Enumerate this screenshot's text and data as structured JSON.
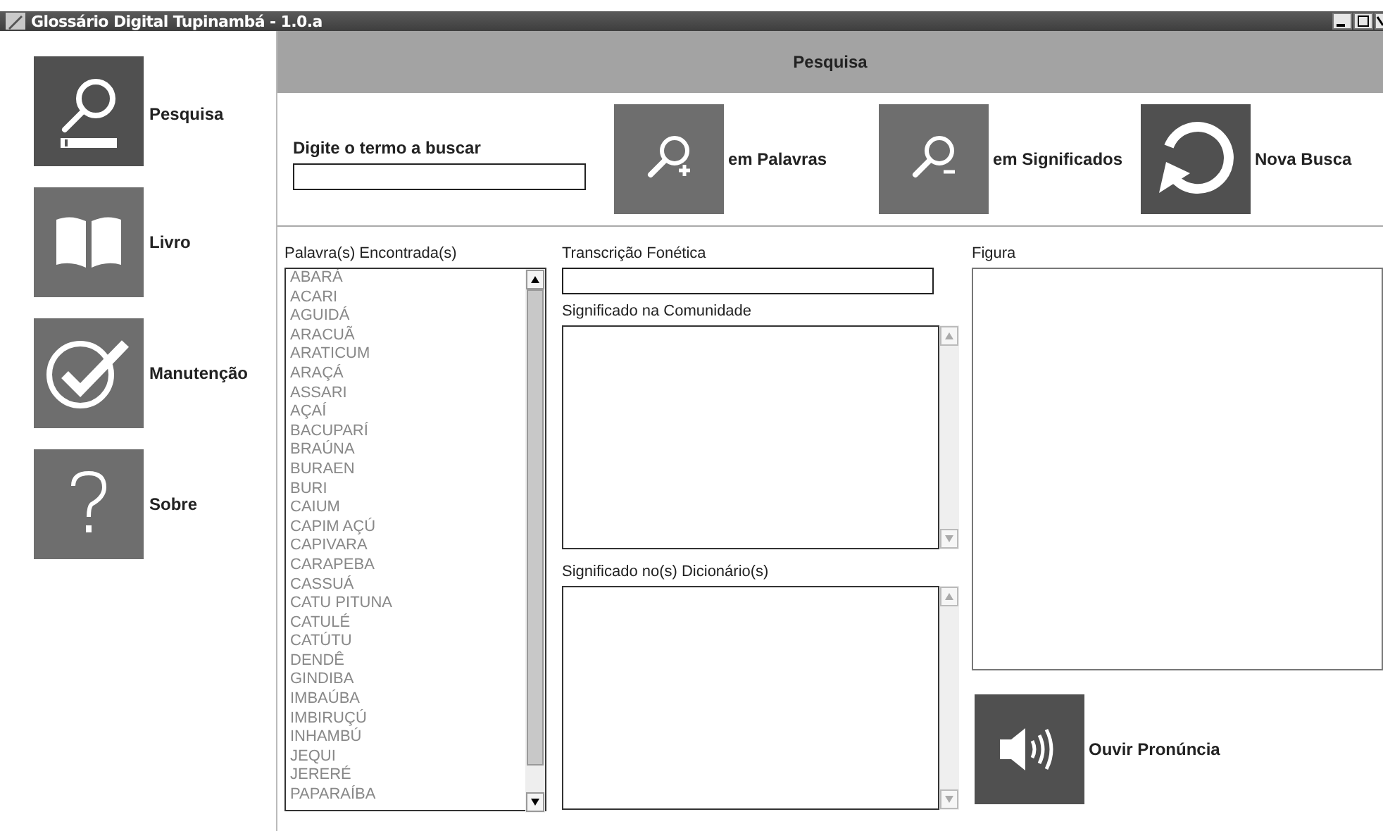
{
  "window": {
    "title": "Glossário Digital Tupinambá - 1.0.a"
  },
  "sidebar": {
    "items": [
      {
        "label": "Pesquisa"
      },
      {
        "label": "Livro"
      },
      {
        "label": "Manutenção"
      },
      {
        "label": "Sobre"
      }
    ]
  },
  "header": {
    "title": "Pesquisa"
  },
  "search": {
    "label": "Digite o termo a buscar",
    "buttons": [
      "em Palavras",
      "em Significados",
      "Nova Busca"
    ]
  },
  "words": {
    "label": "Palavra(s) Encontrada(s)",
    "items": [
      "ABARÁ",
      "ACARI",
      "AGUIDÁ",
      "ARACUÃ",
      "ARATICUM",
      "ARAÇÁ",
      "ASSARI",
      "AÇAÍ",
      "BACUPARÍ",
      "BRAÚNA",
      "BURAEN",
      "BURI",
      "CAIUM",
      "CAPIM AÇÚ",
      "CAPIVARA",
      "CARAPEBA",
      "CASSUÁ",
      "CATU PITUNA",
      "CATULÉ",
      "CATÚTU",
      "DENDÊ",
      "GINDIBA",
      "IMBAÚBA",
      "IMBIRUÇÚ",
      "INHAMBÚ",
      "JEQUI",
      "JERERÉ",
      "PAPARAÍBA"
    ]
  },
  "details": {
    "phonetic_label": "Transcrição Fonética",
    "community_label": "Significado na Comunidade",
    "dictionary_label": "Significado no(s) Dicionário(s)"
  },
  "figure": {
    "label": "Figura"
  },
  "pronounce": {
    "label": "Ouvir Pronúncia"
  }
}
